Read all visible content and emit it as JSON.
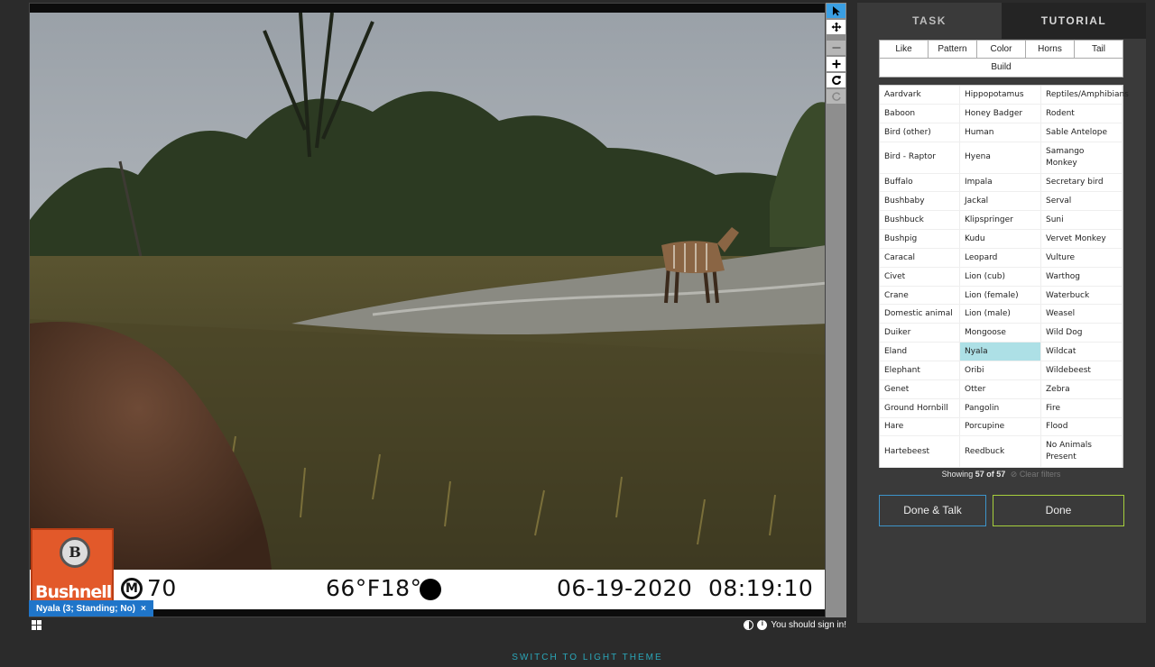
{
  "colors": {
    "background": "#2b2b2b",
    "panel": "#3a3a3a",
    "accent_blue": "#1f75c9",
    "accent_teal": "#2ba6b8",
    "selected_choice": "#ade0e6",
    "done_border": "#a6cf3c",
    "done_talk_border": "#3d94c9"
  },
  "viewer": {
    "logo_text": "Bushnell",
    "logo_badge": "B",
    "stamp": {
      "moon_letter": "M",
      "moon_value": "70",
      "temperature": "66°F18°C",
      "date": "06-19-2020",
      "time": "08:19:10"
    },
    "mark_chip": {
      "label": "Nyala (3; Standing; No)",
      "close": "×"
    }
  },
  "toolbar": [
    {
      "name": "pointer-tool",
      "icon": "cursor-icon",
      "state": "active"
    },
    {
      "name": "move-tool",
      "icon": "move-icon",
      "state": "normal"
    },
    {
      "name": "zoom-out-tool",
      "icon": "minus-icon",
      "state": "disabled"
    },
    {
      "name": "zoom-in-tool",
      "icon": "plus-icon",
      "state": "normal"
    },
    {
      "name": "rotate-tool",
      "icon": "rotate-icon",
      "state": "normal"
    },
    {
      "name": "reset-tool",
      "icon": "reset-icon",
      "state": "disabled"
    }
  ],
  "footer": {
    "sign_in": "You should sign in!",
    "theme_switch": "SWITCH TO LIGHT THEME"
  },
  "task_panel": {
    "tabs": [
      {
        "label": "TASK",
        "active": true
      },
      {
        "label": "TUTORIAL",
        "active": false
      }
    ],
    "filters": [
      "Like",
      "Pattern",
      "Color",
      "Horns",
      "Tail"
    ],
    "filter_build": "Build",
    "choices": [
      "Aardvark",
      "Hippopotamus",
      "Reptiles/Amphibians",
      "Baboon",
      "Honey Badger",
      "Rodent",
      "Bird (other)",
      "Human",
      "Sable Antelope",
      "Bird - Raptor",
      "Hyena",
      "Samango Monkey",
      "Buffalo",
      "Impala",
      "Secretary bird",
      "Bushbaby",
      "Jackal",
      "Serval",
      "Bushbuck",
      "Klipspringer",
      "Suni",
      "Bushpig",
      "Kudu",
      "Vervet Monkey",
      "Caracal",
      "Leopard",
      "Vulture",
      "Civet",
      "Lion (cub)",
      "Warthog",
      "Crane",
      "Lion (female)",
      "Waterbuck",
      "Domestic animal",
      "Lion (male)",
      "Weasel",
      "Duiker",
      "Mongoose",
      "Wild Dog",
      "Eland",
      "Nyala",
      "Wildcat",
      "Elephant",
      "Oribi",
      "Wildebeest",
      "Genet",
      "Otter",
      "Zebra",
      "Ground Hornbill",
      "Pangolin",
      "Fire",
      "Hare",
      "Porcupine",
      "Flood",
      "Hartebeest",
      "Reedbuck",
      "No Animals Present"
    ],
    "selected_choice": "Nyala",
    "showing_prefix": "Showing",
    "showing_count": "57 of 57",
    "clear_filters": "Clear filters",
    "done_talk": "Done & Talk",
    "done": "Done"
  }
}
